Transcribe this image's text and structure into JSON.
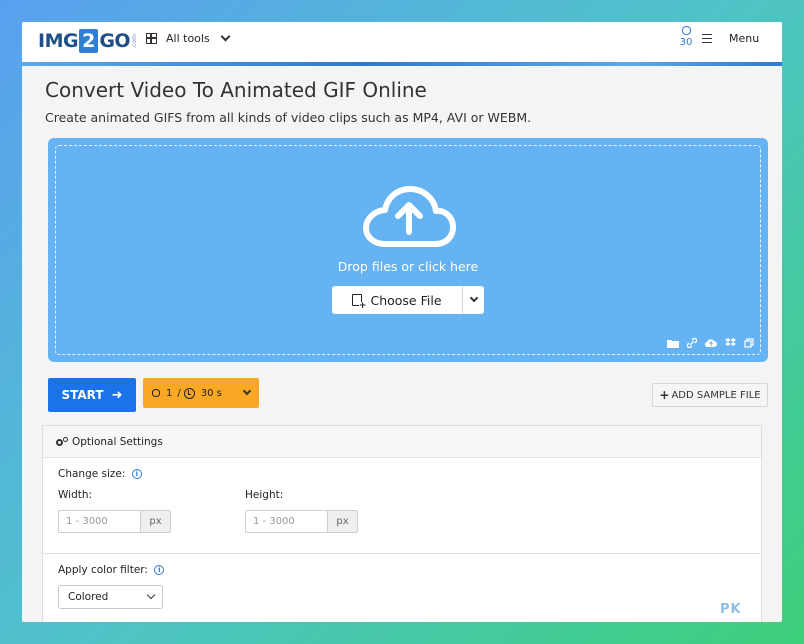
{
  "header": {
    "logo_left": "IMG",
    "logo_mid": "2",
    "logo_right": "GO",
    "logo_suffix": ".com",
    "all_tools_label": "All tools",
    "credits": "30",
    "menu_label": "Menu"
  },
  "main": {
    "title": "Convert Video To Animated GIF Online",
    "subtitle": "Create animated GIFS from all kinds of video clips such as MP4, AVI or WEBM."
  },
  "dropzone": {
    "hint": "Drop files or click here",
    "choose_label": "Choose File",
    "background_color": "#65b3f2"
  },
  "actions": {
    "start_label": "START",
    "limit_files": "1",
    "limit_sep": "/",
    "limit_time": "30 s",
    "sample_label": "ADD SAMPLE FILE",
    "start_color": "#1a73e8",
    "limit_color": "#f9a825"
  },
  "settings": {
    "title": "Optional Settings",
    "change_size_label": "Change size:",
    "width_label": "Width:",
    "height_label": "Height:",
    "width_placeholder": "1 - 3000",
    "height_placeholder": "1 - 3000",
    "unit": "px",
    "color_filter_label": "Apply color filter:",
    "color_filter_value": "Colored"
  },
  "watermark": "PK"
}
